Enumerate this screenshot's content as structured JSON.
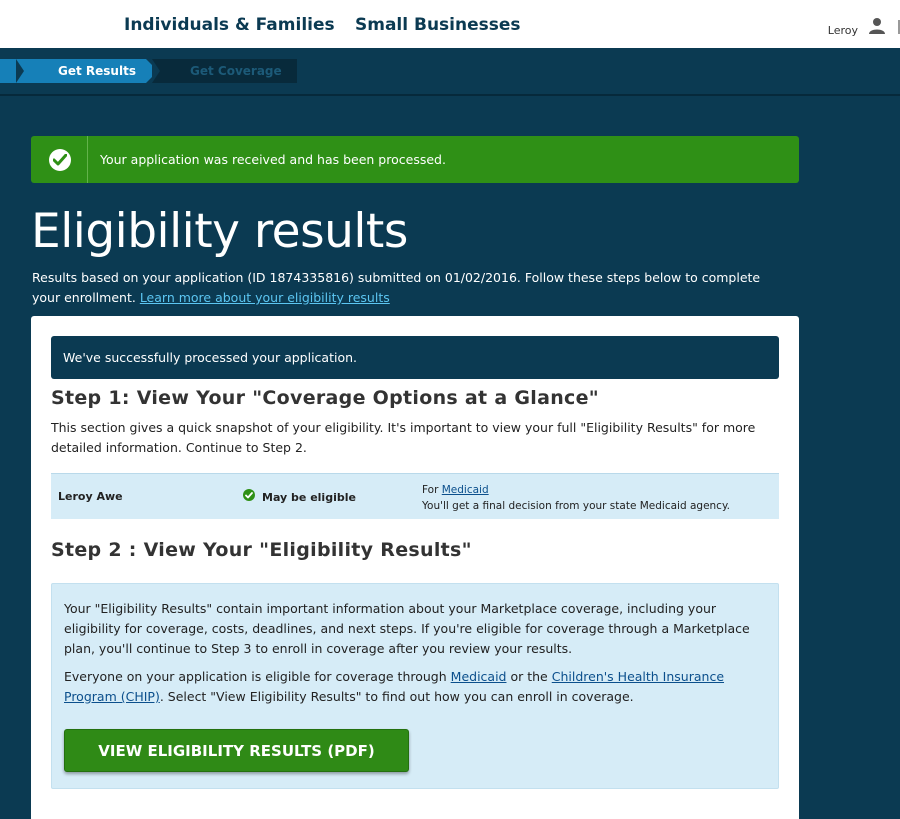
{
  "nav": {
    "individuals": "Individuals & Families",
    "small_business": "Small Businesses",
    "user_name": "Leroy"
  },
  "progress": {
    "step1": "Get Results",
    "step2": "Get Coverage"
  },
  "alert": {
    "text": "Your application was received and has been processed.",
    "color": "#2f9016"
  },
  "page": {
    "title": "Eligibility results",
    "intro_text": "Results based on your application (ID 1874335816) submitted on 01/02/2016. Follow these steps below to complete your enrollment.",
    "intro_link": "Learn more about your eligibility results"
  },
  "card": {
    "banner": "We've successfully processed your application.",
    "step1": {
      "heading": "Step 1: View Your \"Coverage Options at a Glance\"",
      "text": "This section gives a quick snapshot of your eligibility. It's important to view your full \"Eligibility Results\" for more detailed information. Continue to Step 2."
    },
    "result": {
      "name": "Leroy Awe",
      "status": "May be eligible",
      "for_prefix": "For",
      "program": "Medicaid",
      "note": "You'll get a final decision from your state Medicaid agency."
    },
    "step2": {
      "heading": "Step 2 : View Your \"Eligibility Results\"",
      "para1": "Your \"Eligibility Results\" contain important information about your Marketplace coverage, including your eligibility for coverage, costs, deadlines, and next steps. If you're eligible for coverage through a Marketplace plan, you'll continue to Step 3 to enroll in coverage after you review your results.",
      "para2_a": "Everyone on your application is eligible for coverage through",
      "para2_link1": "Medicaid",
      "para2_b": "or the",
      "para2_link2": "Children's Health Insurance Program (CHIP)",
      "para2_c": ". Select \"View Eligibility Results\" to find out how you can enroll in coverage.",
      "button": "VIEW ELIGIBILITY RESULTS (PDF)"
    }
  },
  "colors": {
    "page_bg": "#0b3a52",
    "accent_blue": "#1680b8",
    "success_green": "#2f9016",
    "info_bg": "#d6ecf7"
  }
}
